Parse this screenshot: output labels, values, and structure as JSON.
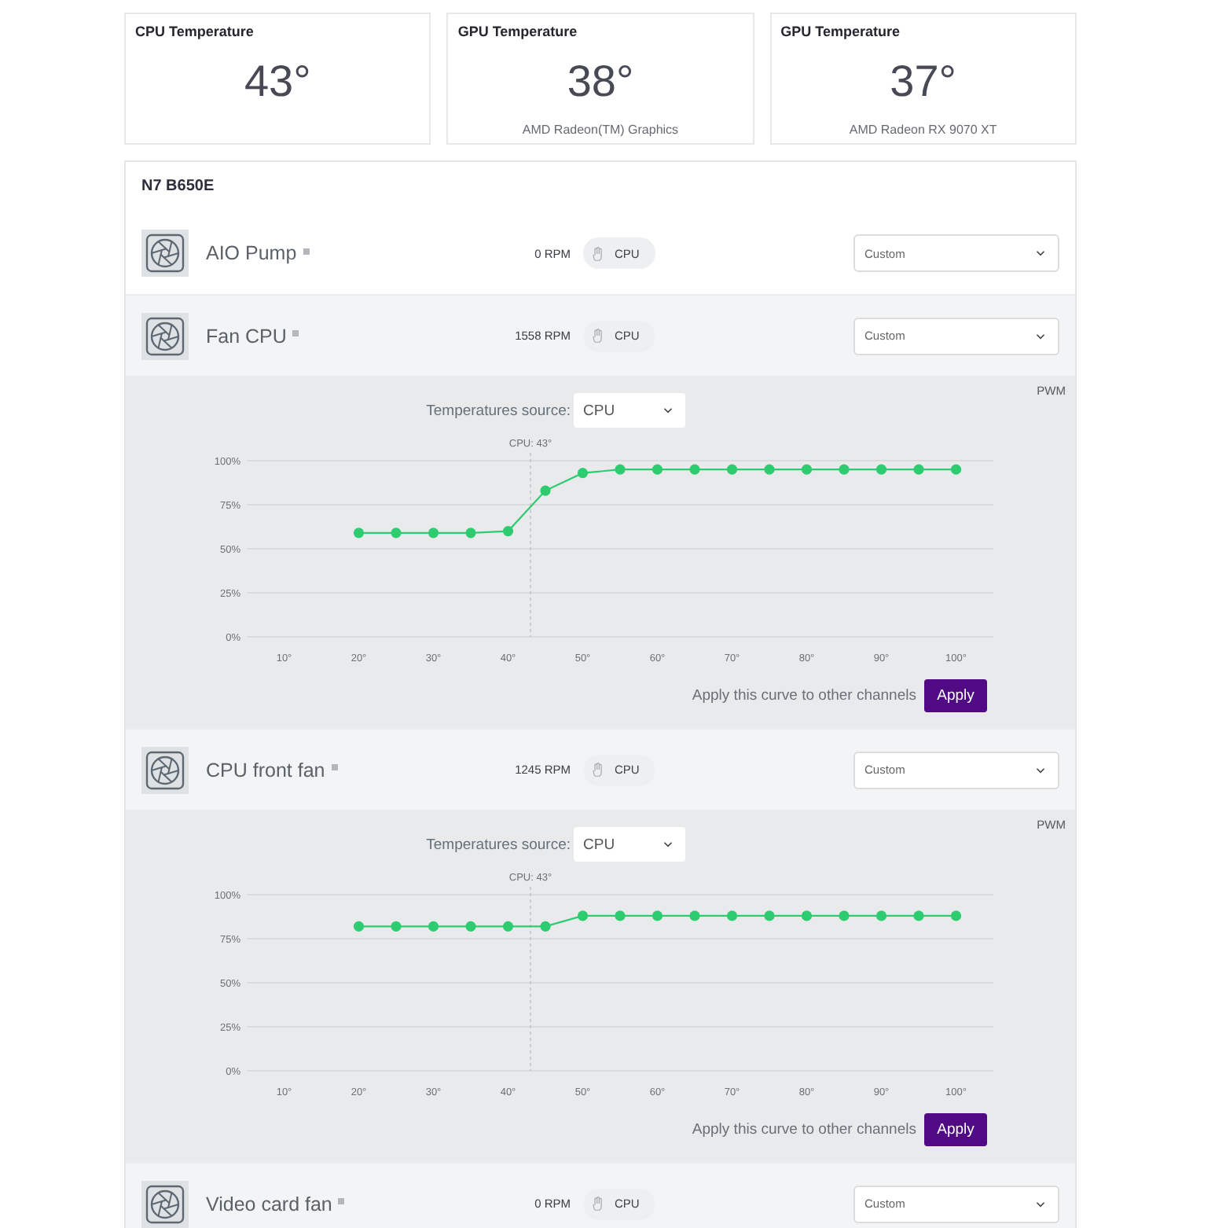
{
  "temperature_cards": [
    {
      "title": "CPU Temperature",
      "value": "43°"
    },
    {
      "title": "GPU Temperature",
      "value": "38°",
      "device": "AMD Radeon(TM) Graphics"
    },
    {
      "title": "GPU Temperature",
      "value": "37°",
      "device": "AMD Radeon RX 9070 XT"
    }
  ],
  "board": {
    "title": "N7 B650E",
    "channels": [
      {
        "name": "AIO Pump",
        "rpm": "0 RPM",
        "source": "CPU",
        "mode": "Custom",
        "expanded": false
      },
      {
        "name": "Fan CPU",
        "rpm": "1558 RPM",
        "source": "CPU",
        "mode": "Custom",
        "expanded": true,
        "curve": {
          "source_label": "Temperatures source:",
          "source_value": "CPU",
          "apply_text": "Apply this curve to other channels",
          "apply_button": "Apply",
          "chart_data": {
            "type": "line",
            "ylabel": "PWM",
            "x": [
              20,
              25,
              30,
              35,
              40,
              45,
              50,
              55,
              60,
              65,
              70,
              75,
              80,
              85,
              90,
              95,
              100
            ],
            "series": [
              {
                "color": "#2ecc71",
                "marker": "circle",
                "values": [
                  59,
                  59,
                  59,
                  59,
                  60,
                  83,
                  93,
                  95,
                  95,
                  95,
                  95,
                  95,
                  95,
                  95,
                  95,
                  95,
                  95
                ]
              }
            ],
            "xlim": [
              5,
              105
            ],
            "ylim": [
              0,
              100
            ],
            "grid": true,
            "xticks": [
              {
                "value": 10,
                "label": "10°"
              },
              {
                "value": 20,
                "label": "20°"
              },
              {
                "value": 30,
                "label": "30°"
              },
              {
                "value": 40,
                "label": "40°"
              },
              {
                "value": 50,
                "label": "50°"
              },
              {
                "value": 60,
                "label": "60°"
              },
              {
                "value": 70,
                "label": "70°"
              },
              {
                "value": 80,
                "label": "80°"
              },
              {
                "value": 90,
                "label": "90°"
              },
              {
                "value": 100,
                "label": "100°"
              }
            ],
            "yticks": [
              {
                "value": 0,
                "label": "0%"
              },
              {
                "value": 25,
                "label": "25%"
              },
              {
                "value": 50,
                "label": "50%"
              },
              {
                "value": 75,
                "label": "75%"
              },
              {
                "value": 100,
                "label": "100%"
              }
            ],
            "ref_lines": [
              {
                "axis": "x",
                "value": 43,
                "label": "CPU: 43°"
              }
            ]
          }
        }
      },
      {
        "name": "CPU front fan",
        "rpm": "1245 RPM",
        "source": "CPU",
        "mode": "Custom",
        "expanded": true,
        "curve": {
          "source_label": "Temperatures source:",
          "source_value": "CPU",
          "apply_text": "Apply this curve to other channels",
          "apply_button": "Apply",
          "chart_data": {
            "type": "line",
            "ylabel": "PWM",
            "x": [
              20,
              25,
              30,
              35,
              40,
              45,
              50,
              55,
              60,
              65,
              70,
              75,
              80,
              85,
              90,
              95,
              100
            ],
            "series": [
              {
                "color": "#2ecc71",
                "marker": "circle",
                "values": [
                  82,
                  82,
                  82,
                  82,
                  82,
                  82,
                  88,
                  88,
                  88,
                  88,
                  88,
                  88,
                  88,
                  88,
                  88,
                  88,
                  88
                ]
              }
            ],
            "xlim": [
              5,
              105
            ],
            "ylim": [
              0,
              100
            ],
            "grid": true,
            "xticks": [
              {
                "value": 10,
                "label": "10°"
              },
              {
                "value": 20,
                "label": "20°"
              },
              {
                "value": 30,
                "label": "30°"
              },
              {
                "value": 40,
                "label": "40°"
              },
              {
                "value": 50,
                "label": "50°"
              },
              {
                "value": 60,
                "label": "60°"
              },
              {
                "value": 70,
                "label": "70°"
              },
              {
                "value": 80,
                "label": "80°"
              },
              {
                "value": 90,
                "label": "90°"
              },
              {
                "value": 100,
                "label": "100°"
              }
            ],
            "yticks": [
              {
                "value": 0,
                "label": "0%"
              },
              {
                "value": 25,
                "label": "25%"
              },
              {
                "value": 50,
                "label": "50%"
              },
              {
                "value": 75,
                "label": "75%"
              },
              {
                "value": 100,
                "label": "100%"
              }
            ],
            "ref_lines": [
              {
                "axis": "x",
                "value": 43,
                "label": "CPU: 43°"
              }
            ]
          }
        }
      },
      {
        "name": "Video card fan",
        "rpm": "0 RPM",
        "source": "CPU",
        "mode": "Custom",
        "expanded": true
      }
    ]
  }
}
